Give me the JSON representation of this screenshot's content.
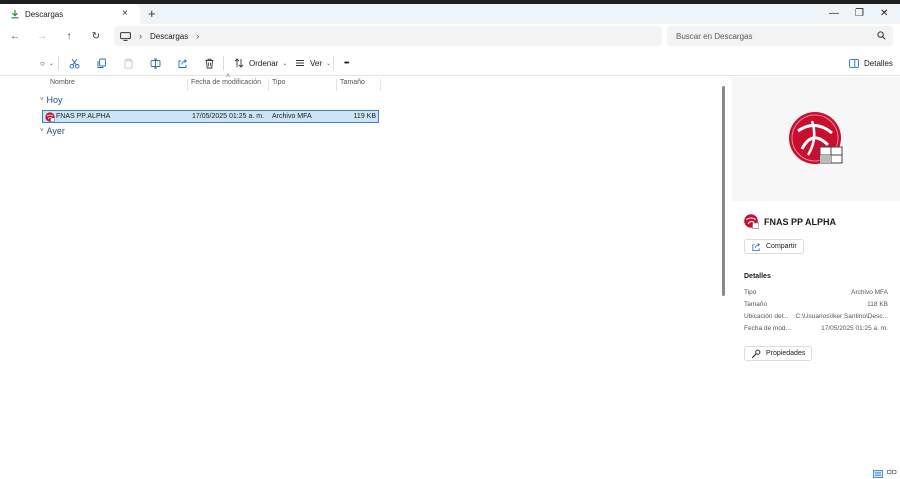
{
  "window": {
    "tab_title": "Descargas",
    "close_tab": "×",
    "new_tab": "+",
    "minimize": "—",
    "maximize": "❐",
    "close": "✕"
  },
  "nav": {
    "back": "←",
    "forward": "→",
    "up": "↑",
    "refresh": "↻",
    "crumb_sep": "›",
    "current_folder": "Descargas",
    "search_placeholder": "Buscar en Descargas"
  },
  "toolbar": {
    "new_caret": "⌄",
    "sort_label": "Ordenar",
    "view_label": "Ver",
    "more": "•••",
    "details_label": "Detalles"
  },
  "columns": [
    "Nombre",
    "Fecha de modificación",
    "Tipo",
    "Tamaño"
  ],
  "groups": [
    {
      "label": "Hoy",
      "files": [
        {
          "name": "FNAS PP ALPHA",
          "modified": "17/05/2025 01:25 a. m.",
          "type": "Archivo MFA",
          "size": "119 KB",
          "selected": true
        }
      ]
    },
    {
      "label": "Ayer",
      "files": []
    }
  ],
  "details": {
    "file_name": "FNAS PP ALPHA",
    "share_label": "Compartir",
    "section_title": "Detalles",
    "properties": [
      {
        "key": "Tipo",
        "value": "Archivo MFA"
      },
      {
        "key": "Tamaño",
        "value": "118 KB"
      },
      {
        "key": "Ubicación del...",
        "value": "C:\\Usuarios\\Iker Santino\\Desc..."
      },
      {
        "key": "Fecha de mod...",
        "value": "17/05/2025 01:25 a. m."
      }
    ],
    "properties_label": "Propiedades"
  },
  "colors": {
    "accent": "#0067c0",
    "selection_bg": "#cce4f7",
    "selection_border": "#3f7fc6",
    "group_text": "#2a4f88",
    "file_icon_red": "#c8102e"
  }
}
